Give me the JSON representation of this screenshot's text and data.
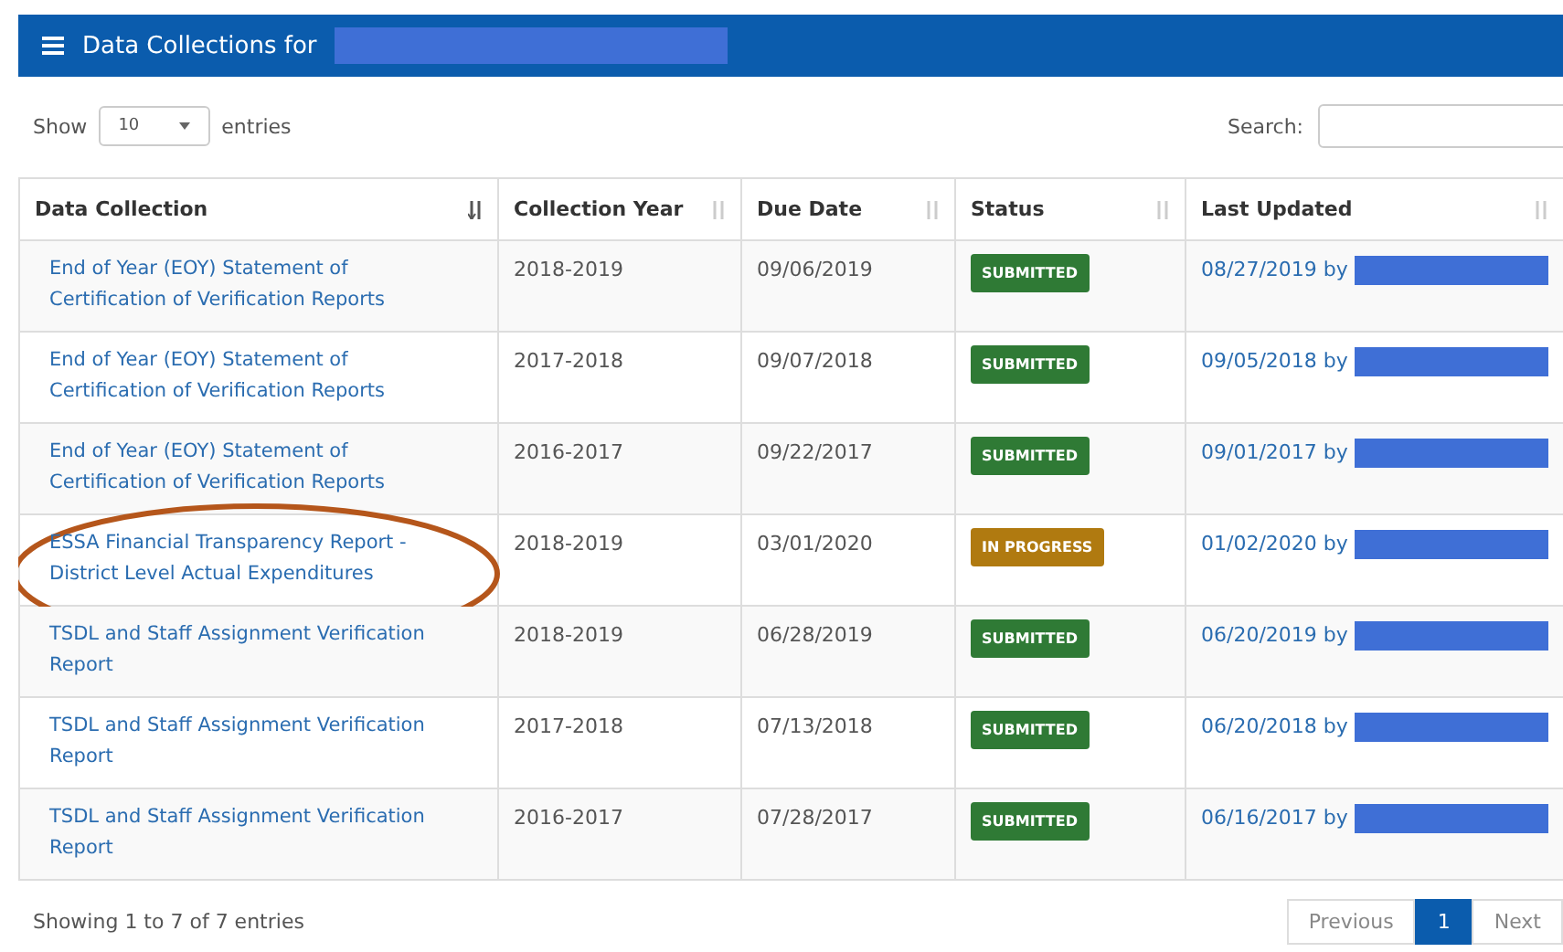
{
  "panel": {
    "title": "Data Collections for"
  },
  "length_control": {
    "before": "Show",
    "value": "10",
    "after": "entries"
  },
  "search": {
    "label": "Search:"
  },
  "table": {
    "columns": [
      {
        "label": "Data Collection",
        "sorted": true
      },
      {
        "label": "Collection Year",
        "sorted": false
      },
      {
        "label": "Due Date",
        "sorted": false
      },
      {
        "label": "Status",
        "sorted": false
      },
      {
        "label": "Last Updated",
        "sorted": false
      }
    ],
    "rows": [
      {
        "name": "End of Year (EOY) Statement of Certification of Verification Reports",
        "year": "2018-2019",
        "due": "09/06/2019",
        "status": {
          "kind": "submitted",
          "label": "SUBMITTED"
        },
        "updated": "08/27/2019 by",
        "circled": false
      },
      {
        "name": "End of Year (EOY) Statement of Certification of Verification Reports",
        "year": "2017-2018",
        "due": "09/07/2018",
        "status": {
          "kind": "submitted",
          "label": "SUBMITTED"
        },
        "updated": "09/05/2018 by",
        "circled": false
      },
      {
        "name": "End of Year (EOY) Statement of Certification of Verification Reports",
        "year": "2016-2017",
        "due": "09/22/2017",
        "status": {
          "kind": "submitted",
          "label": "SUBMITTED"
        },
        "updated": "09/01/2017 by",
        "circled": false
      },
      {
        "name": "ESSA Financial Transparency Report - District Level Actual Expenditures",
        "year": "2018-2019",
        "due": "03/01/2020",
        "status": {
          "kind": "in_progress",
          "label": "IN PROGRESS"
        },
        "updated": "01/02/2020 by",
        "circled": true
      },
      {
        "name": "TSDL and Staff Assignment Verification Report",
        "year": "2018-2019",
        "due": "06/28/2019",
        "status": {
          "kind": "submitted",
          "label": "SUBMITTED"
        },
        "updated": "06/20/2019 by",
        "circled": false
      },
      {
        "name": "TSDL and Staff Assignment Verification Report",
        "year": "2017-2018",
        "due": "07/13/2018",
        "status": {
          "kind": "submitted",
          "label": "SUBMITTED"
        },
        "updated": "06/20/2018 by",
        "circled": false
      },
      {
        "name": "TSDL and Staff Assignment Verification Report",
        "year": "2016-2017",
        "due": "07/28/2017",
        "status": {
          "kind": "submitted",
          "label": "SUBMITTED"
        },
        "updated": "06/16/2017 by",
        "circled": false
      }
    ]
  },
  "info": "Showing 1 to 7 of 7 entries",
  "pagination": [
    {
      "label": "Previous",
      "selected": false
    },
    {
      "label": "1",
      "selected": true
    },
    {
      "label": "Next",
      "selected": false
    }
  ]
}
